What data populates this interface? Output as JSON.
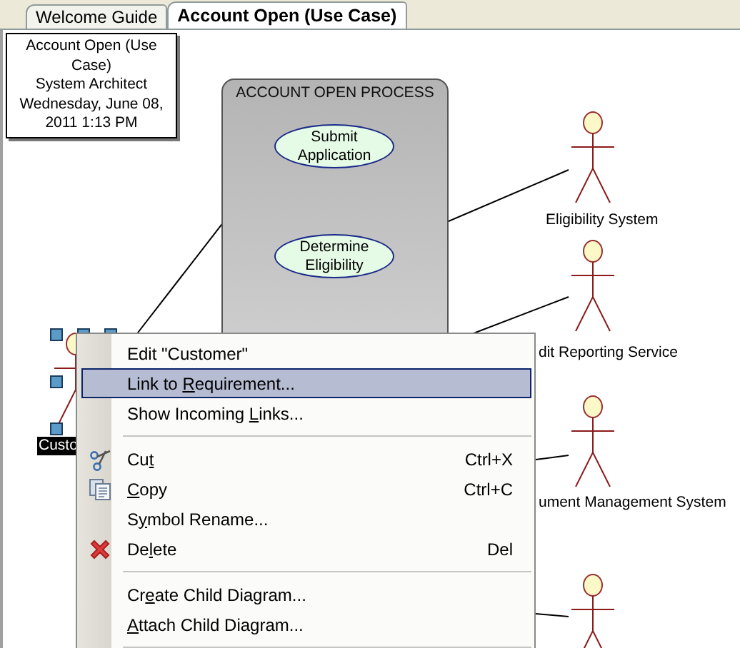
{
  "tabs": [
    {
      "label": "Welcome Guide",
      "selected": false
    },
    {
      "label": "Account Open (Use Case)",
      "selected": true
    }
  ],
  "note": {
    "lines": [
      "Account Open (Use",
      "Case)",
      "System Architect",
      "Wednesday, June 08,",
      "2011 1:13 PM"
    ]
  },
  "boundary": {
    "title": "ACCOUNT OPEN PROCESS",
    "use_cases": [
      {
        "label": "Submit Application"
      },
      {
        "label": "Determine Eligibility"
      }
    ]
  },
  "actors": [
    {
      "kind": "actor",
      "name": "Custo",
      "selected": true
    },
    {
      "kind": "actor",
      "name": "Eligibility System",
      "selected": false
    },
    {
      "kind": "actor",
      "name": "dit Reporting Service",
      "selected": false
    },
    {
      "kind": "actor",
      "name": "ument Management System",
      "selected": false
    },
    {
      "kind": "actor"
    }
  ],
  "context_menu": {
    "items": [
      {
        "kind": "command",
        "label": {
          "before": "Edit \"Customer\""
        },
        "selected": false
      },
      {
        "kind": "command",
        "label": {
          "before": "Link to ",
          "key": "R",
          "after": "equirement..."
        },
        "selected": true
      },
      {
        "kind": "command",
        "label": {
          "before": "Show Incoming ",
          "key": "L",
          "after": "inks..."
        },
        "selected": false
      },
      {
        "kind": "separator"
      },
      {
        "kind": "cut",
        "label": {
          "before": "Cu",
          "key": "t"
        },
        "shortcut": "Ctrl+X",
        "selected": false
      },
      {
        "kind": "copy",
        "label": {
          "key": "C",
          "after": "opy"
        },
        "shortcut": "Ctrl+C",
        "selected": false
      },
      {
        "kind": "command",
        "label": {
          "before": "S",
          "key": "y",
          "after": "mbol Rename..."
        },
        "selected": false
      },
      {
        "kind": "delete",
        "label": {
          "before": "De",
          "key": "l",
          "after": "ete"
        },
        "shortcut": "Del",
        "selected": false
      },
      {
        "kind": "separator"
      },
      {
        "kind": "command",
        "label": {
          "before": "Cr",
          "key": "e",
          "after": "ate Child Diagram..."
        },
        "selected": false
      },
      {
        "kind": "command",
        "label": {
          "key": "A",
          "after": "ttach Child Diagram..."
        },
        "selected": false
      },
      {
        "kind": "separator"
      }
    ]
  }
}
